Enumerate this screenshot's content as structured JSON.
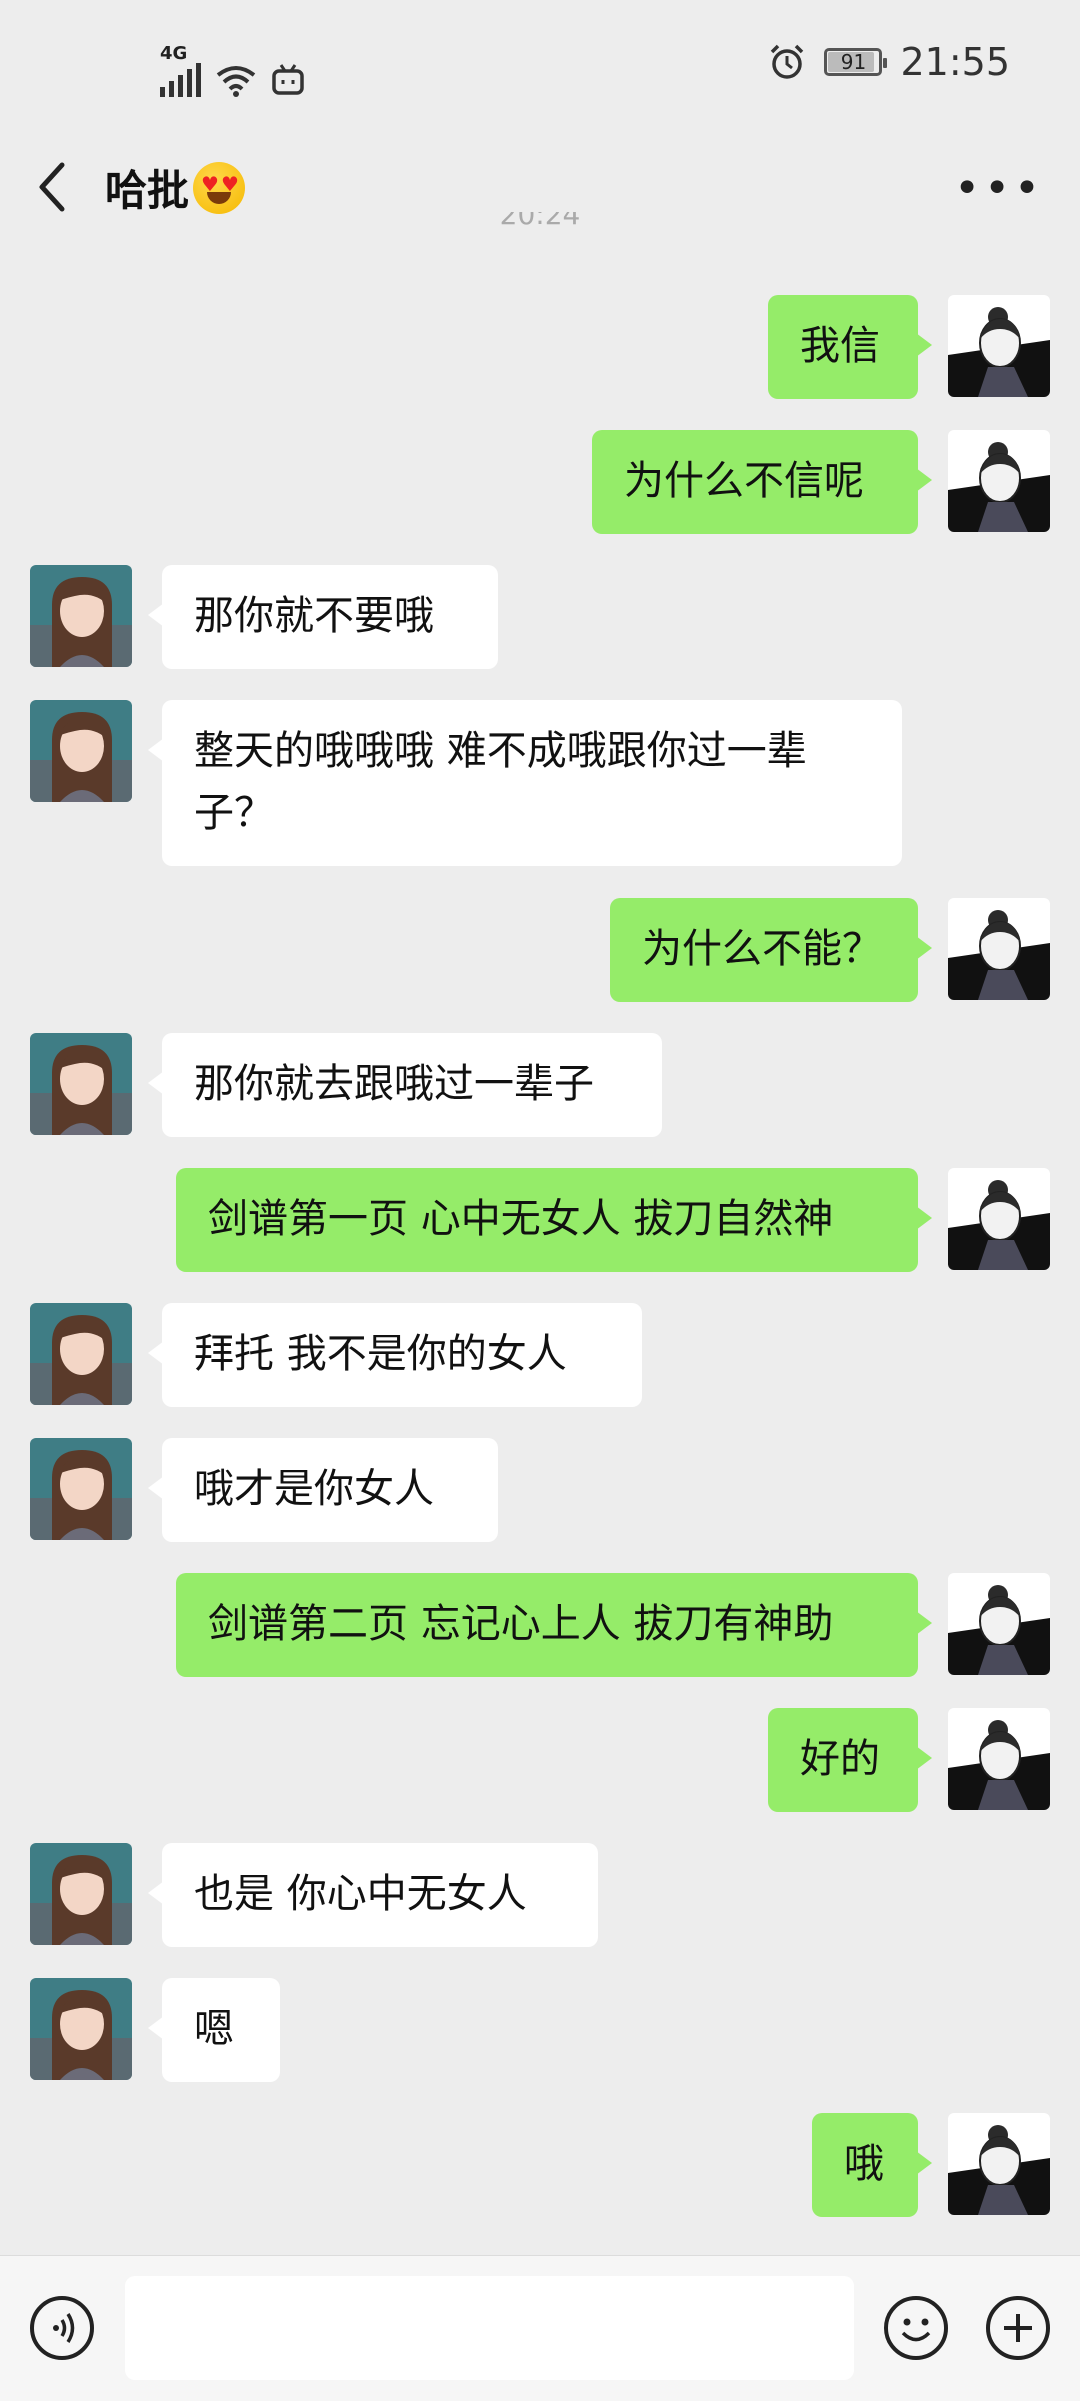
{
  "status": {
    "network": "4G",
    "battery": "91",
    "battery_level": 0.91,
    "time": "21:55"
  },
  "header": {
    "title": "哈批",
    "title_emoji": "heart-eyes-emoji"
  },
  "timestamp": "20:24",
  "colors": {
    "sent_bubble": "#95ec69",
    "received_bubble": "#ffffff",
    "background": "#ededed"
  },
  "messages": [
    {
      "side": "sent",
      "text": "我信"
    },
    {
      "side": "sent",
      "text": "为什么不信呢"
    },
    {
      "side": "received",
      "text": "那你就不要哦"
    },
    {
      "side": "received",
      "text": "整天的哦哦哦 难不成哦跟你过一辈子？"
    },
    {
      "side": "sent",
      "text": "为什么不能？"
    },
    {
      "side": "received",
      "text": "那你就去跟哦过一辈子"
    },
    {
      "side": "sent",
      "text": "剑谱第一页 心中无女人 拔刀自然神"
    },
    {
      "side": "received",
      "text": "拜托 我不是你的女人"
    },
    {
      "side": "received",
      "text": "哦才是你女人"
    },
    {
      "side": "sent",
      "text": "剑谱第二页 忘记心上人 拔刀有神助"
    },
    {
      "side": "sent",
      "text": "好的"
    },
    {
      "side": "received",
      "text": "也是 你心中无女人"
    },
    {
      "side": "received",
      "text": "嗯"
    },
    {
      "side": "sent",
      "text": "哦"
    }
  ],
  "input": {
    "placeholder": ""
  }
}
